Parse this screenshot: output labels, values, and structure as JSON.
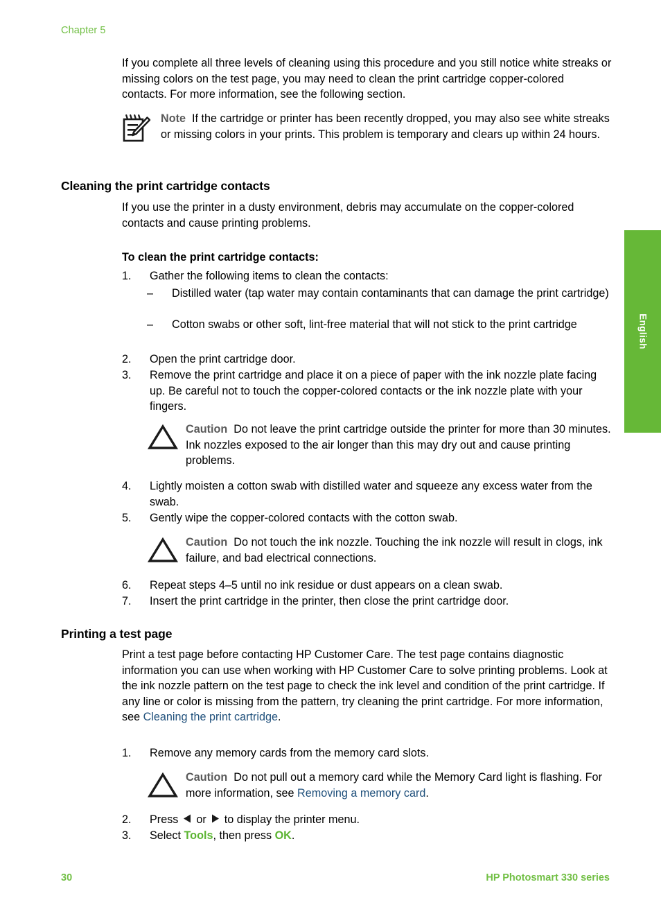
{
  "document": {
    "chapter_label": "Chapter 5",
    "language_tab": "English",
    "footer": {
      "page_number": "30",
      "product": "HP Photosmart 330 series"
    },
    "colors": {
      "brand_green": "#71BF44",
      "tab_green": "#66B837",
      "link_blue": "#21517C",
      "inline_green": "#5BB431",
      "admonition_keyword_gray": "#5A5A5A"
    }
  },
  "intro": {
    "paragraph": "If you complete all three levels of cleaning using this procedure and you still notice white streaks or missing colors on the test page, you may need to clean the print cartridge copper-colored contacts. For more information, see the following section."
  },
  "note": {
    "icon": "note-pencil-icon",
    "keyword": "Note",
    "text": "If the cartridge or printer has been recently dropped, you may also see white streaks or missing colors in your prints. This problem is temporary and clears up within 24 hours."
  },
  "section_cleaning": {
    "heading": "Cleaning the print cartridge contacts",
    "paragraph": "If you use the printer in a dusty environment, debris may accumulate on the copper-colored contacts and cause printing problems.",
    "procedure_heading": "To clean the print cartridge contacts:",
    "steps": [
      {
        "num": "1.",
        "text": "Gather the following items to clean the contacts:"
      },
      {
        "num": "2.",
        "text": "Open the print cartridge door."
      },
      {
        "num": "3.",
        "text": "Remove the print cartridge and place it on a piece of paper with the ink nozzle plate facing up. Be careful not to touch the copper-colored contacts or the ink nozzle plate with your fingers."
      },
      {
        "num": "4.",
        "text": "Lightly moisten a cotton swab with distilled water and squeeze any excess water from the swab."
      },
      {
        "num": "5.",
        "text": "Gently wipe the copper-colored contacts with the cotton swab."
      },
      {
        "num": "6.",
        "text": "Repeat steps 4–5 until no ink residue or dust appears on a clean swab."
      },
      {
        "num": "7.",
        "text": "Insert the print cartridge in the printer, then close the print cartridge door."
      }
    ],
    "sub_items": [
      {
        "mark": "–",
        "text": "Distilled water (tap water may contain contaminants that can damage the print cartridge)"
      },
      {
        "mark": "–",
        "text": "Cotton swabs or other soft, lint-free material that will not stick to the print cartridge"
      }
    ],
    "caution_1": {
      "icon": "caution-triangle-icon",
      "keyword": "Caution",
      "text": "Do not leave the print cartridge outside the printer for more than 30 minutes. Ink nozzles exposed to the air longer than this may dry out and cause printing problems."
    },
    "caution_2": {
      "icon": "caution-triangle-icon",
      "keyword": "Caution",
      "text": "Do not touch the ink nozzle. Touching the ink nozzle will result in clogs, ink failure, and bad electrical connections."
    }
  },
  "section_test_page": {
    "heading": "Printing a test page",
    "paragraph_part1": "Print a test page before contacting HP Customer Care. The test page contains diagnostic information you can use when working with HP Customer Care to solve printing problems. Look at the ink nozzle pattern on the test page to check the ink level and condition of the print cartridge. If any line or color is missing from the pattern, try cleaning the print cartridge. For more information, see ",
    "link_text": "Cleaning the print cartridge",
    "paragraph_part2": ".",
    "steps": [
      {
        "num": "1.",
        "text": "Remove any memory cards from the memory card slots."
      }
    ],
    "caution": {
      "icon": "caution-triangle-icon",
      "keyword": "Caution",
      "text_part1": "Do not pull out a memory card while the Memory Card light is flashing. For more information, see ",
      "link_text": "Removing a memory card",
      "text_part2": "."
    },
    "step_2": {
      "num": "2.",
      "text_part1": "Press ",
      "left_arrow": "left-arrow-icon",
      "text_part2": " or ",
      "right_arrow": "right-arrow-icon",
      "text_part3": " to display the printer menu."
    },
    "step_3": {
      "num": "3.",
      "text_part1": "Select ",
      "highlight1": "Tools",
      "text_part2": ", then press ",
      "highlight2": "OK",
      "text_part3": "."
    }
  }
}
